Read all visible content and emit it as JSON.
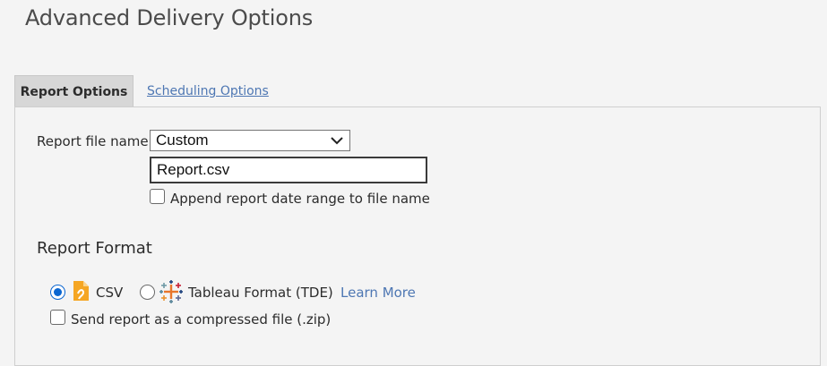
{
  "page": {
    "title": "Advanced Delivery Options"
  },
  "tabs": [
    {
      "label": "Report Options",
      "active": true
    },
    {
      "label": "Scheduling Options",
      "active": false
    }
  ],
  "report_options": {
    "file_name_label": "Report file name:",
    "file_name_mode": {
      "selected": "Custom"
    },
    "file_name_value": "Report.csv",
    "append_date_range": {
      "label": "Append report date range to file name",
      "checked": false
    }
  },
  "report_format": {
    "heading": "Report Format",
    "options": [
      {
        "label": "CSV",
        "icon": "csv-file-icon",
        "selected": true
      },
      {
        "label": "Tableau Format (TDE)",
        "icon": "tableau-icon",
        "selected": false
      }
    ],
    "learn_more": "Learn More",
    "compressed": {
      "label": "Send report as a compressed file (.zip)",
      "checked": false
    }
  },
  "colors": {
    "link": "#4e77b3",
    "radio_accent": "#0a66d1",
    "csv_icon": "#f5a623"
  }
}
